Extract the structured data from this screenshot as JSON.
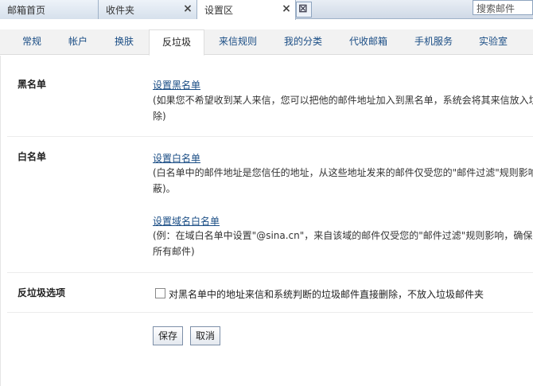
{
  "window_tabs": [
    {
      "label": "邮箱首页"
    },
    {
      "label": "收件夹"
    },
    {
      "label": "设置区"
    }
  ],
  "search": {
    "placeholder": "搜索邮件"
  },
  "settings_tabs": [
    {
      "label": "常规"
    },
    {
      "label": "帐户"
    },
    {
      "label": "换肤"
    },
    {
      "label": "反垃圾",
      "active": true
    },
    {
      "label": "来信规则"
    },
    {
      "label": "我的分类"
    },
    {
      "label": "代收邮箱"
    },
    {
      "label": "手机服务"
    },
    {
      "label": "实验室"
    }
  ],
  "blacklist": {
    "title": "黑名单",
    "link": "设置黑名单",
    "desc_line1": "(如果您不希望收到某人来信，您可以把他的邮件地址加入到黑名单，系统会将其来信放入垃",
    "desc_line2": "除)"
  },
  "whitelist": {
    "title": "白名单",
    "link": "设置白名单",
    "desc_line1": "(白名单中的邮件地址是您信任的地址，从这些地址发来的邮件仅受您的\"邮件过滤\"规则影响",
    "desc_line2": "蔽)。",
    "domain_link": "设置域名白名单",
    "domain_desc_line1": "(例：在域白名单中设置\"@sina.cn\"，来自该域的邮件仅受您的\"邮件过滤\"规则影响，确保",
    "domain_desc_line2": "所有邮件)"
  },
  "antispam": {
    "title": "反垃圾选项",
    "checkbox_label": "对黑名单中的地址来信和系统判断的垃圾邮件直接删除，不放入垃圾邮件夹",
    "checked": false
  },
  "buttons": {
    "save": "保存",
    "cancel": "取消"
  }
}
